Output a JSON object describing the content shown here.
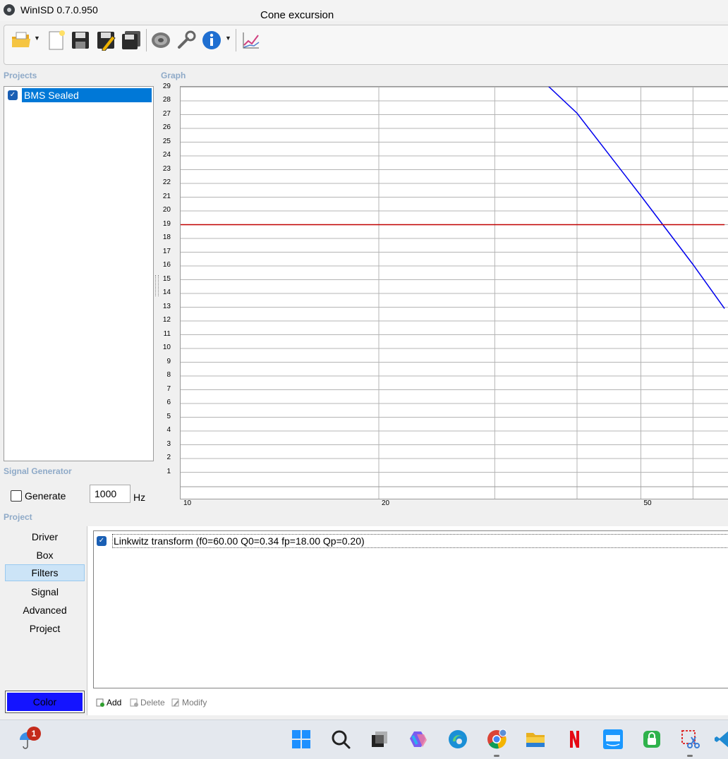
{
  "window": {
    "title": "WinISD 0.7.0.950"
  },
  "toolbar": {
    "icons": [
      "open-folder-icon",
      "new-document-icon",
      "save-icon",
      "save-as-icon",
      "save-all-icon",
      "speaker-icon",
      "wrench-icon",
      "info-icon",
      "cone-excursion-icon"
    ],
    "cone_excursion_label": "Cone excursion"
  },
  "projects": {
    "section_label": "Projects",
    "items": [
      {
        "label": "BMS Sealed",
        "checked": true
      }
    ]
  },
  "graph": {
    "section_label": "Graph",
    "y_ticks": [
      "29",
      "28",
      "27",
      "26",
      "25",
      "24",
      "23",
      "22",
      "21",
      "20",
      "19",
      "18",
      "17",
      "16",
      "15",
      "14",
      "13",
      "12",
      "11",
      "10",
      "9",
      "8",
      "7",
      "6",
      "5",
      "4",
      "3",
      "2",
      "1"
    ],
    "x_ticks": [
      "10",
      "20",
      "50"
    ]
  },
  "chart_data": {
    "type": "line",
    "xscale": "log",
    "xlim": [
      10,
      67
    ],
    "ylim": [
      0,
      30
    ],
    "grid": true,
    "series": [
      {
        "color": "#0000ee",
        "x": [
          34.5,
          40,
          50,
          60,
          67
        ],
        "y": [
          30,
          27.1,
          21.1,
          16.1,
          12.9
        ]
      },
      {
        "color": "#c00000",
        "x": [
          10,
          67
        ],
        "y": [
          19,
          19
        ]
      }
    ]
  },
  "signal_generator": {
    "section_label": "Signal Generator",
    "generate_label": "Generate",
    "generate_checked": false,
    "frequency_value": "1000",
    "unit": "Hz"
  },
  "project_panel": {
    "section_label": "Project",
    "nav": [
      "Driver",
      "Box",
      "Filters",
      "Signal",
      "Advanced",
      "Project"
    ],
    "active": "Filters",
    "color_button_label": "Color",
    "color_value": "#1414ff"
  },
  "filters": {
    "items": [
      {
        "label": "Linkwitz transform (f0=60.00 Q0=0.34 fp=18.00 Qp=0.20)",
        "checked": true
      }
    ],
    "add_label": "Add",
    "delete_label": "Delete",
    "modify_label": "Modify"
  },
  "taskbar": {
    "weather_badge": "1",
    "apps": [
      "weather-icon",
      "windows-start-icon",
      "search-icon",
      "task-view-icon",
      "copilot-icon",
      "edge-icon",
      "chrome-icon",
      "file-explorer-icon",
      "netflix-icon",
      "prime-video-icon",
      "password-manager-icon",
      "snipping-tool-icon",
      "vscode-icon"
    ]
  },
  "colors": {
    "selection": "#0078d7",
    "grid": "#b4b4b4",
    "excursion_line": "#0000ee",
    "limit_line": "#c00000"
  }
}
